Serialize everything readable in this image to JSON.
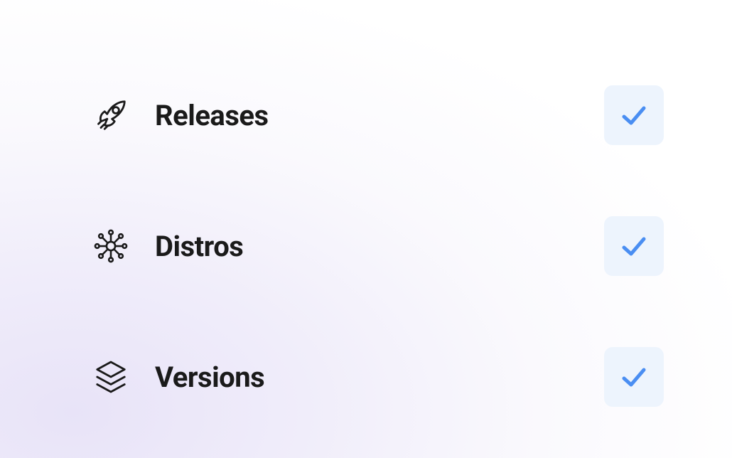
{
  "items": [
    {
      "icon": "rocket",
      "label": "Releases",
      "checked": true
    },
    {
      "icon": "hub",
      "label": "Distros",
      "checked": true
    },
    {
      "icon": "layers",
      "label": "Versions",
      "checked": true
    }
  ],
  "colors": {
    "text": "#1a1a1a",
    "check": "#4a8ef2",
    "checkBg": "#edf4fd"
  }
}
